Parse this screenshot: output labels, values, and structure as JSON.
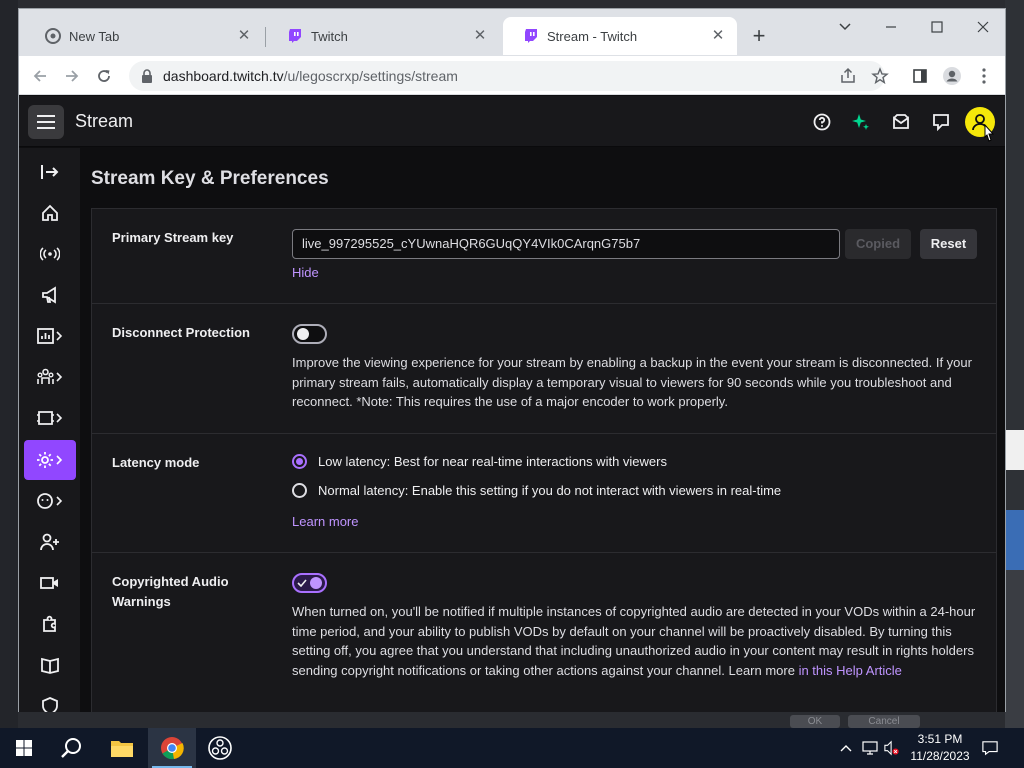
{
  "browser": {
    "tabs": [
      {
        "label": "New Tab"
      },
      {
        "label": "Twitch"
      },
      {
        "label": "Stream - Twitch"
      }
    ],
    "url_host": "dashboard.twitch.tv",
    "url_path": "/u/legoscrxp/settings/stream"
  },
  "app": {
    "page_heading": "Stream"
  },
  "content": {
    "section_title": "Stream Key & Preferences",
    "stream_key": {
      "label": "Primary Stream key",
      "value": "live_997295525_cYUwnaHQR6GUqQY4VIk0CArqnG75b7",
      "copied_label": "Copied",
      "reset_label": "Reset",
      "hide_label": "Hide"
    },
    "disconnect": {
      "label": "Disconnect Protection",
      "enabled": false,
      "description": "Improve the viewing experience for your stream by enabling a backup in the event your stream is disconnected. If your primary stream fails, automatically display a temporary visual to viewers for 90 seconds while you troubleshoot and reconnect. *Note: This requires the use of a major encoder to work properly."
    },
    "latency": {
      "label": "Latency mode",
      "options": [
        {
          "label": "Low latency: Best for near real-time interactions with viewers",
          "checked": true
        },
        {
          "label": "Normal latency: Enable this setting if you do not interact with viewers in real-time",
          "checked": false
        }
      ],
      "learn_more": "Learn more"
    },
    "copyright": {
      "label": "Copyrighted Audio Warnings",
      "enabled": true,
      "description": "When turned on, you'll be notified if multiple instances of copyrighted audio are detected in your VODs within a 24-hour time period, and your ability to publish VODs by default on your channel will be proactively disabled. By turning this setting off, you agree that you understand that including unauthorized audio in your content may result in rights holders sending copyright notifications or taking other actions against your channel. Learn more ",
      "link": "in this Help Article"
    }
  },
  "background": {
    "ok_label": "OK",
    "cancel_label": "Cancel"
  },
  "taskbar": {
    "time": "3:51 PM",
    "date": "11/28/2023"
  },
  "colors": {
    "accent": "#9147ff",
    "link": "#bf94ff"
  }
}
